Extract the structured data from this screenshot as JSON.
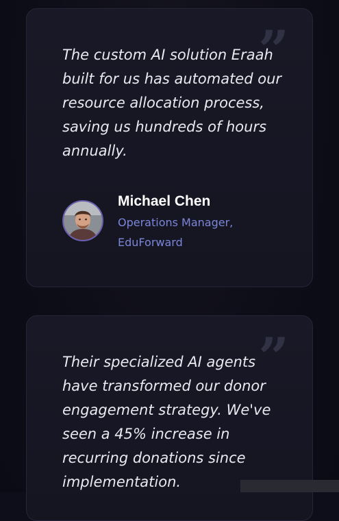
{
  "testimonials": [
    {
      "quote": "The custom AI solution Eraah built for us has automated our resource allocation process, saving us hundreds of hours annually.",
      "author_name": "Michael Chen",
      "author_role": "Operations Manager, EduForward"
    },
    {
      "quote": "Their specialized AI agents have transformed our donor engagement strategy. We've seen a 45% increase in recurring donations since implementation."
    }
  ],
  "quote_glyph": "”",
  "colors": {
    "background": "#0e0e1a",
    "card": "#181826",
    "role_accent": "#7b86d9",
    "avatar_ring": "#6a5fb0"
  },
  "icons": {
    "quote": "quote-icon"
  }
}
